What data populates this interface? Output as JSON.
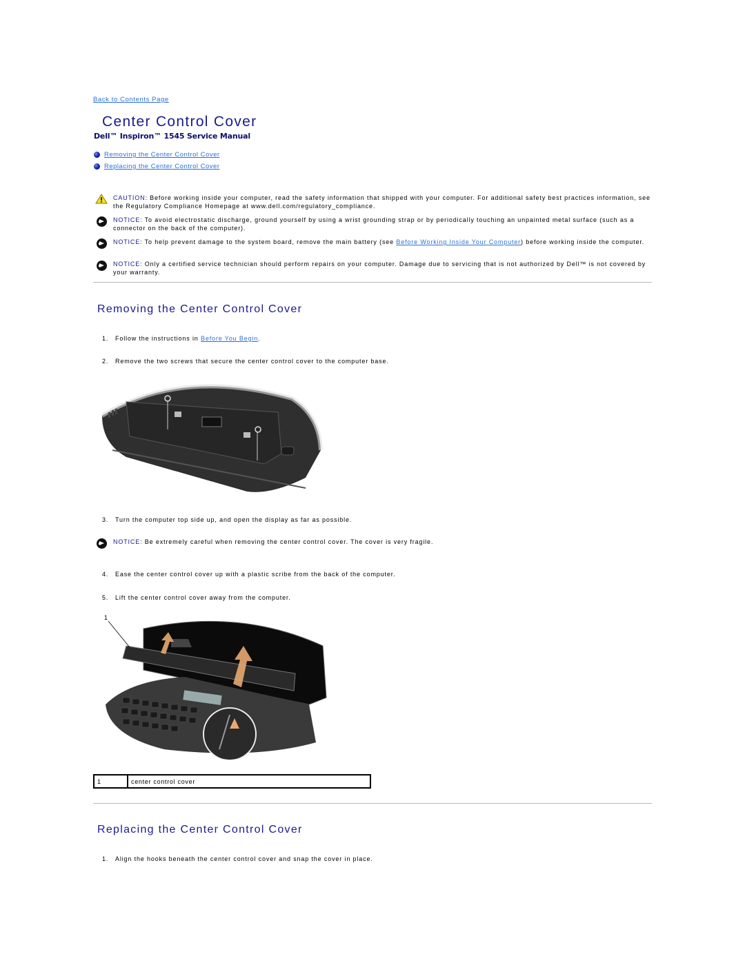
{
  "nav": {
    "back_link": "Back to Contents Page"
  },
  "header": {
    "title": "Center Control Cover",
    "subtitle": "Dell™ Inspiron™ 1545 Service Manual"
  },
  "toc": [
    {
      "label": "Removing the Center Control Cover",
      "icon": "blue-bullet-icon"
    },
    {
      "label": "Replacing the Center Control Cover",
      "icon": "blue-bullet-icon"
    }
  ],
  "notes": {
    "caution": {
      "icon": "warning-triangle-icon",
      "label": "CAUTION:",
      "text": " Before working inside your computer, read the safety information that shipped with your computer. For additional safety best practices information, see the Regulatory Compliance Homepage at www.dell.com/regulatory_compliance."
    },
    "notice_1": {
      "icon": "notice-arrow-icon",
      "label": "NOTICE:",
      "text": " To avoid electrostatic discharge, ground yourself by using a wrist grounding strap or by periodically touching an unpainted metal surface (such as a connector on the back of the computer)."
    },
    "notice_2": {
      "icon": "notice-arrow-icon",
      "label": "NOTICE:",
      "text_before": " To help prevent damage to the system board, remove the main battery (see ",
      "link": "Before Working Inside Your Computer",
      "text_after": ") before working inside the computer."
    },
    "notice_3": {
      "icon": "notice-arrow-icon",
      "label": "NOTICE:",
      "text": " Only a certified service technician should perform repairs on your computer. Damage due to servicing that is not authorized by Dell™ is not covered by your warranty."
    },
    "notice_4": {
      "icon": "notice-arrow-icon",
      "label": "NOTICE:",
      "text": " Be extremely careful when removing the center control cover. The cover is very fragile."
    }
  },
  "removing": {
    "heading": "Removing the Center Control Cover",
    "steps": [
      {
        "num": "1.",
        "text_before": "Follow the instructions in ",
        "link": "Before You Begin",
        "text_after": "."
      },
      {
        "num": "2.",
        "text": "Remove the two screws that secure the center control cover to the computer base."
      },
      {
        "num": "3.",
        "text": "Turn the computer top side up, and open the display as far as possible."
      },
      {
        "num": "4.",
        "text": "Ease the center control cover up with a plastic scribe from the back of the computer."
      },
      {
        "num": "5.",
        "text": "Lift the center control cover away from the computer."
      }
    ],
    "figure_2_callout": "1",
    "callouts": [
      {
        "num": "1",
        "label": "center control cover"
      }
    ]
  },
  "replacing": {
    "heading": "Replacing the Center Control Cover",
    "steps": [
      {
        "num": "1.",
        "text": "Align the hooks beneath the center control cover and snap the cover in place."
      }
    ]
  }
}
